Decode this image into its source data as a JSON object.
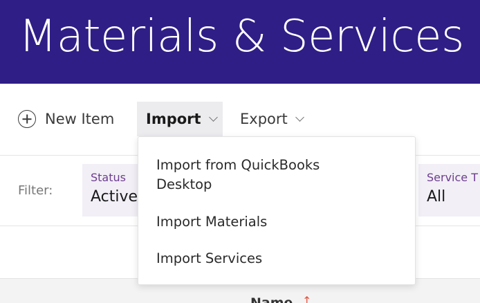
{
  "header": {
    "title": "Materials & Services",
    "bg_color": "#2f1e86"
  },
  "toolbar": {
    "new_item_label": "New Item",
    "new_item_icon": "plus-circle-icon",
    "import_label": "Import",
    "export_label": "Export"
  },
  "filters": {
    "label": "Filter:",
    "status": {
      "caption": "Status",
      "value": "Active"
    },
    "service_type": {
      "caption": "Service T",
      "value": "All"
    }
  },
  "table": {
    "columns": [
      {
        "label": "Name",
        "sort": "ascending"
      }
    ]
  },
  "import_menu": {
    "items": [
      {
        "label": "Import from QuickBooks Desktop"
      },
      {
        "label": "Import Materials"
      },
      {
        "label": "Import Services"
      }
    ]
  }
}
